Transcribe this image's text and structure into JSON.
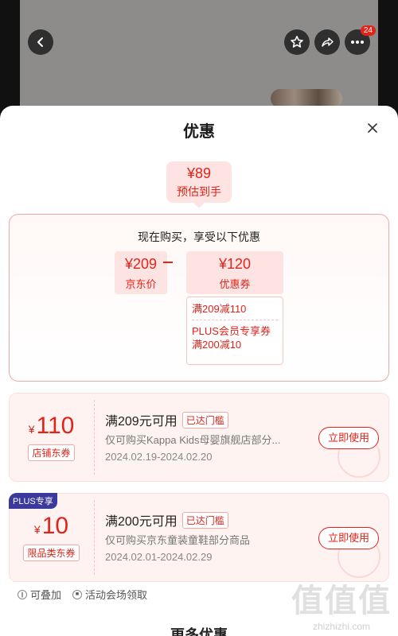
{
  "topbar": {
    "back_icon": "back-arrow-icon",
    "favorite_icon": "star-icon",
    "share_icon": "share-icon",
    "more_icon": "more-dots-icon",
    "message_count": "24"
  },
  "sheet": {
    "title": "优惠",
    "close_icon": "close-icon"
  },
  "estimate": {
    "price": "¥89",
    "label": "预估到手"
  },
  "calc": {
    "heading": "现在购买，享受以下优惠",
    "base_price": "¥209",
    "base_label": "京东价",
    "discount_price": "¥120",
    "discount_label": "优惠券",
    "details": [
      "满209减110",
      "PLUS会员专享券",
      "满200减10"
    ]
  },
  "coupons": [
    {
      "symbol": "¥",
      "amount": "110",
      "type": "店铺东券",
      "condition": "满209元可用",
      "reached": "已达门槛",
      "description": "仅可购买Kappa Kids母婴旗舰店部分...",
      "validity": "2024.02.19-2024.02.20",
      "action": "立即使用"
    },
    {
      "badge": "PLUS专享",
      "symbol": "¥",
      "amount": "10",
      "type": "限品类东券",
      "condition": "满200元可用",
      "reached": "已达门槛",
      "description": "仅可购买京东童装童鞋部分商品",
      "validity": "2024.02.01-2024.02.29",
      "action": "立即使用"
    }
  ],
  "tips": {
    "stackable": "可叠加",
    "venue": "活动会场领取"
  },
  "more_title": "更多优惠",
  "watermark": {
    "text": "值值值",
    "domain": "zhizhizhi.com"
  },
  "colors": {
    "accent": "#e2231a",
    "plus": "#3b3a9c"
  }
}
